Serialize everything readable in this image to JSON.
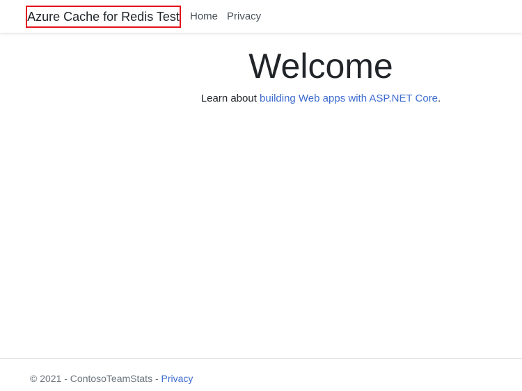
{
  "navbar": {
    "brand": "Azure Cache for Redis Test",
    "links": [
      {
        "label": "Home"
      },
      {
        "label": "Privacy"
      }
    ]
  },
  "main": {
    "title": "Welcome",
    "intro_text": "Learn about ",
    "intro_link": "building Web apps with ASP.NET Core",
    "intro_end": "."
  },
  "footer": {
    "copyright": "© 2021 - ContosoTeamStats - ",
    "privacy_link": "Privacy"
  },
  "colors": {
    "link": "#3d6ccf",
    "highlight_border": "#e3121b",
    "text": "#212529",
    "muted": "#6c757d"
  }
}
